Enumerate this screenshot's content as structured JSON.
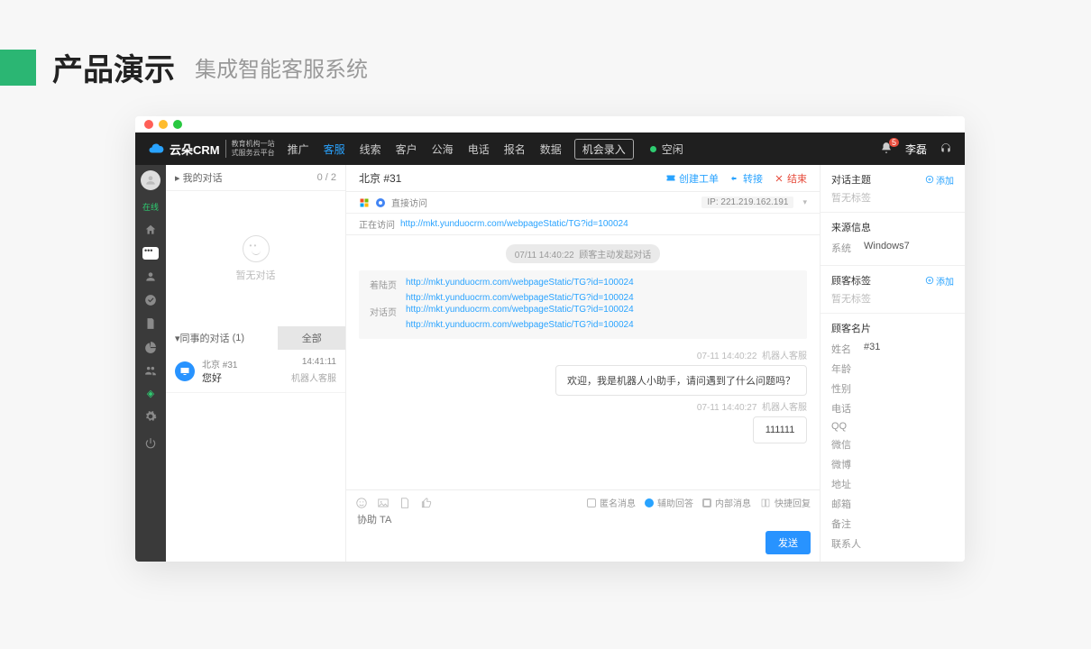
{
  "page": {
    "title": "产品演示",
    "subtitle": "集成智能客服系统"
  },
  "brand": {
    "name": "云朵CRM",
    "sub1": "教育机构一站",
    "sub2": "式服务云平台"
  },
  "nav": {
    "items": [
      "推广",
      "客服",
      "线索",
      "客户",
      "公海",
      "电话",
      "报名",
      "数据"
    ],
    "activeIndex": 1,
    "record_btn": "机会录入",
    "status": "空闲"
  },
  "topright": {
    "badge": "5",
    "user": "李磊"
  },
  "rail": {
    "status": "在线"
  },
  "sections": {
    "mine": {
      "label": "我的对话",
      "count": "0 / 2",
      "empty": "暂无对话"
    },
    "colleague": {
      "label": "同事的对话",
      "count": "(1)",
      "tab_all": "全部"
    }
  },
  "conv": {
    "name": "北京 #31",
    "time": "14:41:11",
    "msg": "您好",
    "src": "机器人客服"
  },
  "chat": {
    "title": "北京 #31",
    "actions": {
      "ticket": "创建工单",
      "transfer": "转接",
      "end": "结束"
    },
    "direct_visit": "直接访问",
    "visiting_label": "正在访问",
    "visiting_url": "http://mkt.yunduocrm.com/webpageStatic/TG?id=100024",
    "ip_label": "IP:",
    "ip_value": "221.219.162.191",
    "sys_msg_time": "07/11 14:40:22",
    "sys_msg_text": "顾客主动发起对话",
    "info": {
      "landing_label": "着陆页",
      "landing1": "http://mkt.yunduocrm.com/webpageStatic/TG?id=100024",
      "landing2": "http://mkt.yunduocrm.com/webpageStatic/TG?id=100024",
      "dialog_label": "对话页",
      "dialog1": "http://mkt.yunduocrm.com/webpageStatic/TG?id=100024",
      "dialog2": "http://mkt.yunduocrm.com/webpageStatic/TG?id=100024"
    },
    "m1_time": "07-11 14:40:22",
    "m1_src": "机器人客服",
    "m1_text": "欢迎，我是机器人小助手，请问遇到了什么问题吗？",
    "m2_time": "07-11 14:40:27",
    "m2_src": "机器人客服",
    "m2_text": "111111"
  },
  "composer": {
    "anon": "匿名消息",
    "assist": "辅助回答",
    "internal": "内部消息",
    "quick": "快捷回复",
    "placeholder": "协助 TA",
    "send": "发送"
  },
  "right": {
    "topic": "对话主题",
    "add": "添加",
    "no_tag": "暂无标签",
    "source_head": "来源信息",
    "source_sys_label": "系统",
    "source_sys_value": "Windows7",
    "tags_head": "顾客标签",
    "card_head": "顾客名片",
    "card": {
      "name_label": "姓名",
      "name_value": "#31",
      "age_label": "年龄",
      "gender_label": "性别",
      "phone_label": "电话",
      "qq_label": "QQ",
      "wechat_label": "微信",
      "weibo_label": "微博",
      "addr_label": "地址",
      "email_label": "邮箱",
      "remark_label": "备注",
      "contact_label": "联系人"
    }
  }
}
